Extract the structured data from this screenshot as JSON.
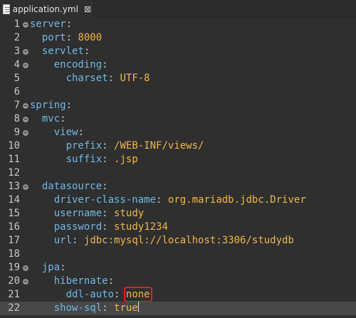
{
  "tab": {
    "label": "application.yml",
    "close_glyph": "⊠"
  },
  "lines": [
    {
      "n": "1",
      "key": "server",
      "indent": "",
      "value": "",
      "fold": true
    },
    {
      "n": "2",
      "key": "port",
      "indent": "  ",
      "value": "8000",
      "fold": false
    },
    {
      "n": "3",
      "key": "servlet",
      "indent": "  ",
      "value": "",
      "fold": true
    },
    {
      "n": "4",
      "key": "encoding",
      "indent": "    ",
      "value": "",
      "fold": true
    },
    {
      "n": "5",
      "key": "charset",
      "indent": "      ",
      "value": "UTF-8",
      "fold": false
    },
    {
      "n": "6",
      "key": "",
      "indent": "",
      "value": "",
      "fold": false
    },
    {
      "n": "7",
      "key": "spring",
      "indent": "",
      "value": "",
      "fold": true
    },
    {
      "n": "8",
      "key": "mvc",
      "indent": "  ",
      "value": "",
      "fold": true
    },
    {
      "n": "9",
      "key": "view",
      "indent": "    ",
      "value": "",
      "fold": true
    },
    {
      "n": "10",
      "key": "prefix",
      "indent": "      ",
      "value": "/WEB-INF/views/",
      "fold": false
    },
    {
      "n": "11",
      "key": "suffix",
      "indent": "      ",
      "value": ".jsp",
      "fold": false
    },
    {
      "n": "12",
      "key": "",
      "indent": "",
      "value": "",
      "fold": false
    },
    {
      "n": "13",
      "key": "datasource",
      "indent": "  ",
      "value": "",
      "fold": true
    },
    {
      "n": "14",
      "key": "driver-class-name",
      "indent": "    ",
      "value": "org.mariadb.jdbc.Driver",
      "fold": false
    },
    {
      "n": "15",
      "key": "username",
      "indent": "    ",
      "value": "study",
      "fold": false
    },
    {
      "n": "16",
      "key": "password",
      "indent": "    ",
      "value": "study1234",
      "fold": false
    },
    {
      "n": "17",
      "key": "url",
      "indent": "    ",
      "value": "jdbc:mysql://localhost:3306/studydb",
      "fold": false
    },
    {
      "n": "18",
      "key": "",
      "indent": "",
      "value": "",
      "fold": false
    },
    {
      "n": "19",
      "key": "jpa",
      "indent": "  ",
      "value": "",
      "fold": true
    },
    {
      "n": "20",
      "key": "hibernate",
      "indent": "    ",
      "value": "",
      "fold": true
    },
    {
      "n": "21",
      "key": "ddl-auto",
      "indent": "      ",
      "value": "none",
      "fold": false,
      "highlight": true
    },
    {
      "n": "22",
      "key": "show-sql",
      "indent": "    ",
      "value": "true",
      "fold": false,
      "current": true
    }
  ],
  "colors": {
    "background": "#2f2f2f",
    "current_line": "#474747",
    "key": "#6fb9e5",
    "value": "#f0b84a",
    "highlight_box": "#e02020"
  },
  "icons": {
    "tab_icon": "yaml-file-icon",
    "fold": "fold-collapse-icon"
  }
}
